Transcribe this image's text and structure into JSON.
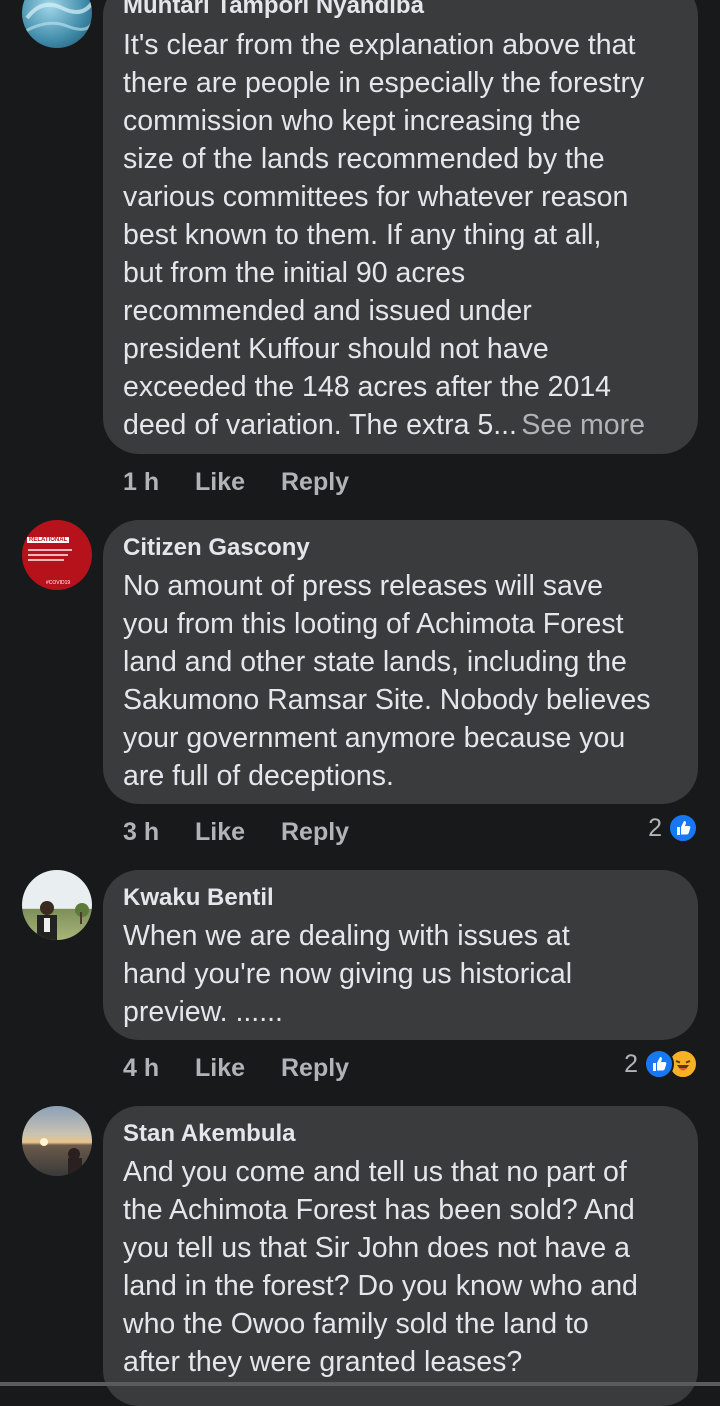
{
  "comments": [
    {
      "author": "Muntari Tampori Nyandiba",
      "text": "It's clear from the explanation above that\nthere are people in especially the forestry\ncommission who kept increasing the\nsize of the lands recommended by the\nvarious committees for whatever reason\nbest known to them. If any thing at all,\nbut from the initial 90 acres\nrecommended and issued under\npresident Kuffour should not have\nexceeded the 148 acres after the 2014\ndeed of variation. The extra 5...",
      "see_more": "See more",
      "time": "1 h",
      "like": "Like",
      "reply": "Reply"
    },
    {
      "author": "Citizen Gascony",
      "text": "No amount of press releases will save\nyou from this looting of Achimota Forest\nland and other state lands, including the\nSakumono Ramsar Site. Nobody believes\nyour government anymore because you\nare full of deceptions.",
      "time": "3 h",
      "like": "Like",
      "reply": "Reply",
      "reaction_count": "2",
      "avatar_badge": "RELATIONAL",
      "avatar_tag": "#COVID19"
    },
    {
      "author": "Kwaku Bentil",
      "text": "When we are dealing with  issues at\nhand you're now giving us historical\npreview. ......",
      "time": "4 h",
      "like": "Like",
      "reply": "Reply",
      "reaction_count": "2"
    },
    {
      "author": "Stan Akembula",
      "text": "And you come and tell us that no part of\nthe Achimota Forest has been sold? And\nyou tell us that Sir John does not have a\nland in the forest? Do you know who and\nwho the Owoo family sold the land to\nafter they were granted leases?"
    }
  ],
  "colors": {
    "background": "#18191a",
    "bubble": "#3a3b3c",
    "text": "#e4e6eb",
    "secondary": "#b0b3b8",
    "like_blue": "#1877f2",
    "haha_yellow": "#f7b125"
  },
  "icons": {
    "like_reaction": "thumbs-up-icon",
    "haha_reaction": "laughing-face-icon"
  }
}
